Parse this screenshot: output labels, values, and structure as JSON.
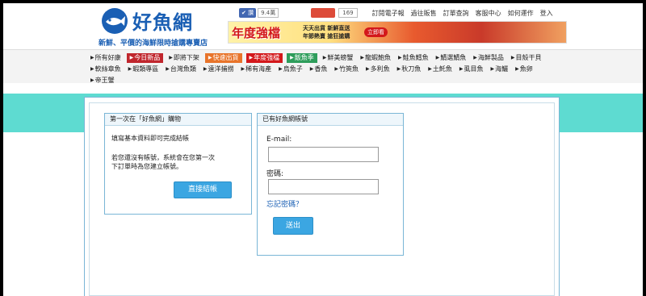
{
  "header": {
    "logo_title": "好魚網",
    "slogan": "新鮮、平價的海鮮限時搶購專賣店",
    "fb_like": "讚",
    "fb_count": "9.4萬",
    "plus_count": "169",
    "top_links": [
      "訂閱電子報",
      "過往販售",
      "訂單查詢",
      "客服中心",
      "如何運作",
      "登入"
    ]
  },
  "banner": {
    "main_text": "年度強檔",
    "sub_lines": [
      "天天出貨 新鮮直送",
      "年節熱賣 搶狂搶購"
    ],
    "button": "立即看"
  },
  "categories": {
    "row1": [
      {
        "label": "所有好康",
        "bg": ""
      },
      {
        "label": "今日新品",
        "bg": "#c0262d"
      },
      {
        "label": "即將下架",
        "bg": ""
      },
      {
        "label": "快速出貨",
        "bg": "#e8742a"
      },
      {
        "label": "年度強檔",
        "bg": "#d3181b"
      },
      {
        "label": "飯魚季",
        "bg": "#2e9d5b"
      },
      {
        "label": "鮮美螃蟹",
        "bg": ""
      },
      {
        "label": "龍蝦鮑魚",
        "bg": ""
      },
      {
        "label": "鮭魚鱈魚",
        "bg": ""
      },
      {
        "label": "鯖選鯖魚",
        "bg": ""
      },
      {
        "label": "海鮮製品",
        "bg": ""
      },
      {
        "label": "目殼干貝",
        "bg": ""
      }
    ],
    "row2": [
      {
        "label": "軟絲章魚",
        "bg": ""
      },
      {
        "label": "蝦類專區",
        "bg": ""
      },
      {
        "label": "台灣魚類",
        "bg": ""
      },
      {
        "label": "遠洋捕撈",
        "bg": ""
      },
      {
        "label": "稀有海產",
        "bg": ""
      },
      {
        "label": "烏魚子",
        "bg": ""
      },
      {
        "label": "香魚",
        "bg": ""
      },
      {
        "label": "竹筴魚",
        "bg": ""
      },
      {
        "label": "多利魚",
        "bg": ""
      },
      {
        "label": "秋刀魚",
        "bg": ""
      },
      {
        "label": "土魠魚",
        "bg": ""
      },
      {
        "label": "虱目魚",
        "bg": ""
      },
      {
        "label": "海鱺",
        "bg": ""
      },
      {
        "label": "魚卵",
        "bg": ""
      }
    ],
    "row3": [
      {
        "label": "帝王蟹",
        "bg": ""
      }
    ]
  },
  "first_time": {
    "heading": "第一次在「好魚網」購物",
    "line1": "填寫基本資料即可完成結帳",
    "line2a": "若您還沒有帳號，系統會在您第一次",
    "line2b": "下訂單時為您建立帳號。",
    "button": "直接結帳"
  },
  "login": {
    "heading": "已有好魚網帳號",
    "email_label": "E-mail:",
    "email_value": "",
    "password_label": "密碼:",
    "password_value": "",
    "forgot_link": "忘記密碼？",
    "submit_button": "送出"
  },
  "colors": {
    "brand_blue": "#1a5fb4",
    "teal_band": "#5edbd1",
    "button_blue": "#3ba6e2"
  }
}
